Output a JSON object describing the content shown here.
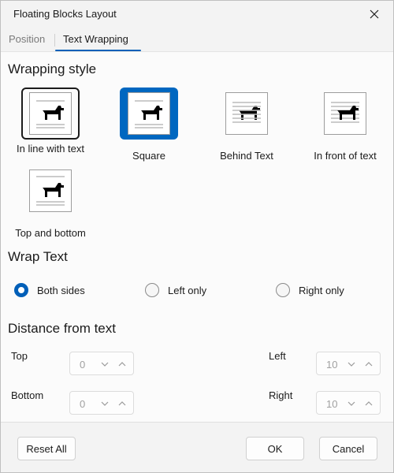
{
  "window": {
    "title": "Floating Blocks Layout"
  },
  "tabs": [
    {
      "label": "Position",
      "active": false
    },
    {
      "label": "Text Wrapping",
      "active": true
    }
  ],
  "wrapping_style": {
    "heading": "Wrapping style",
    "options": [
      {
        "label": "In line with text",
        "selected": false,
        "icon": "dog-icon"
      },
      {
        "label": "Square",
        "selected": true,
        "icon": "dog-icon"
      },
      {
        "label": "Behind Text",
        "selected": false,
        "icon": "dog-icon"
      },
      {
        "label": "In front of text",
        "selected": false,
        "icon": "dog-icon"
      },
      {
        "label": "Top and bottom",
        "selected": false,
        "icon": "dog-icon"
      }
    ]
  },
  "wrap_text": {
    "heading": "Wrap Text",
    "options": [
      {
        "label": "Both sides",
        "checked": true
      },
      {
        "label": "Left only",
        "checked": false
      },
      {
        "label": "Right only",
        "checked": false
      }
    ]
  },
  "distance": {
    "heading": "Distance from text",
    "top": {
      "label": "Top",
      "value": "0"
    },
    "bottom": {
      "label": "Bottom",
      "value": "0"
    },
    "left": {
      "label": "Left",
      "value": "10"
    },
    "right": {
      "label": "Right",
      "value": "10"
    }
  },
  "footer": {
    "reset_label": "Reset All",
    "ok_label": "OK",
    "cancel_label": "Cancel"
  },
  "colors": {
    "accent": "#005fb8",
    "selected_fill": "#0067c0"
  }
}
